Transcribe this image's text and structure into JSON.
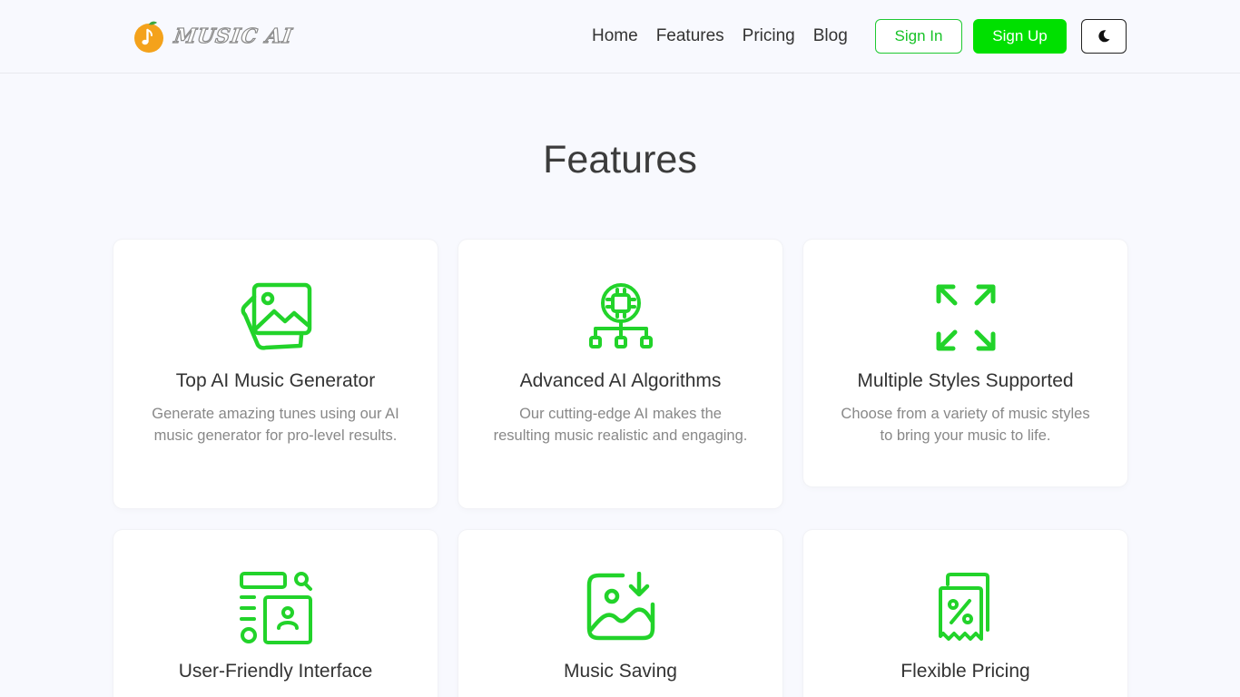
{
  "brand": {
    "name": "MUSIC AI"
  },
  "nav": {
    "items": [
      "Home",
      "Features",
      "Pricing",
      "Blog"
    ],
    "sign_in": "Sign In",
    "sign_up": "Sign Up",
    "theme_icon": "moon-icon"
  },
  "colors": {
    "accent": "#1fd41f",
    "signup_bg": "#00e000",
    "logo_orange": "#f4a21b"
  },
  "section": {
    "title": "Features"
  },
  "features": [
    {
      "title": "Top AI Music Generator",
      "desc": "Generate amazing tunes using our AI music generator for pro-level results.",
      "icon": "image-stack-icon"
    },
    {
      "title": "Advanced AI Algorithms",
      "desc": "Our cutting-edge AI makes the resulting music realistic and engaging.",
      "icon": "chip-network-icon"
    },
    {
      "title": "Multiple Styles Supported",
      "desc": "Choose from a variety of music styles to bring your music to life.",
      "icon": "expand-arrows-icon"
    },
    {
      "title": "User-Friendly Interface",
      "desc": "",
      "icon": "layout-search-icon"
    },
    {
      "title": "Music Saving",
      "desc": "",
      "icon": "image-download-icon"
    },
    {
      "title": "Flexible Pricing",
      "desc": "",
      "icon": "receipt-percent-icon"
    }
  ]
}
